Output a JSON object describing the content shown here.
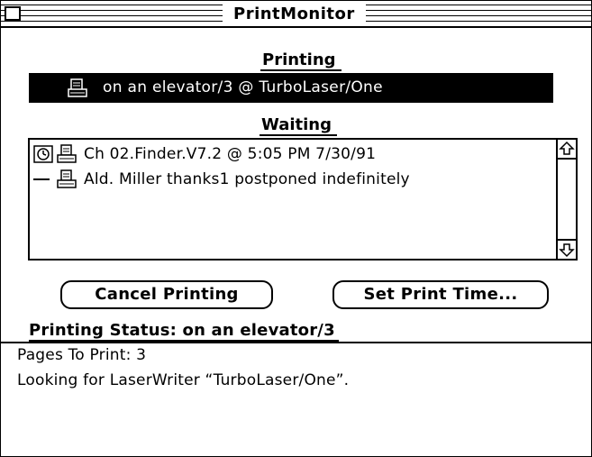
{
  "window": {
    "title": "PrintMonitor"
  },
  "printing": {
    "heading": "Printing",
    "current_job": "on an elevator/3 @ TurboLaser/One",
    "job_icon": "printer-document-icon"
  },
  "waiting": {
    "heading": "Waiting",
    "jobs": [
      {
        "text": "Ch 02.Finder.V7.2 @ 5:05 PM 7/30/91",
        "status_icon": "clock-icon",
        "doc_icon": "printer-document-icon"
      },
      {
        "text": "Ald. Miller thanks1 postponed indefinitely",
        "status_icon": "dash-icon",
        "doc_icon": "printer-document-icon"
      }
    ]
  },
  "buttons": {
    "cancel_printing": "Cancel Printing",
    "set_print_time": "Set Print Time..."
  },
  "status": {
    "heading": "Printing Status: on an elevator/3",
    "lines": [
      "Pages To Print: 3",
      "Looking for LaserWriter “TurboLaser/One”."
    ]
  }
}
